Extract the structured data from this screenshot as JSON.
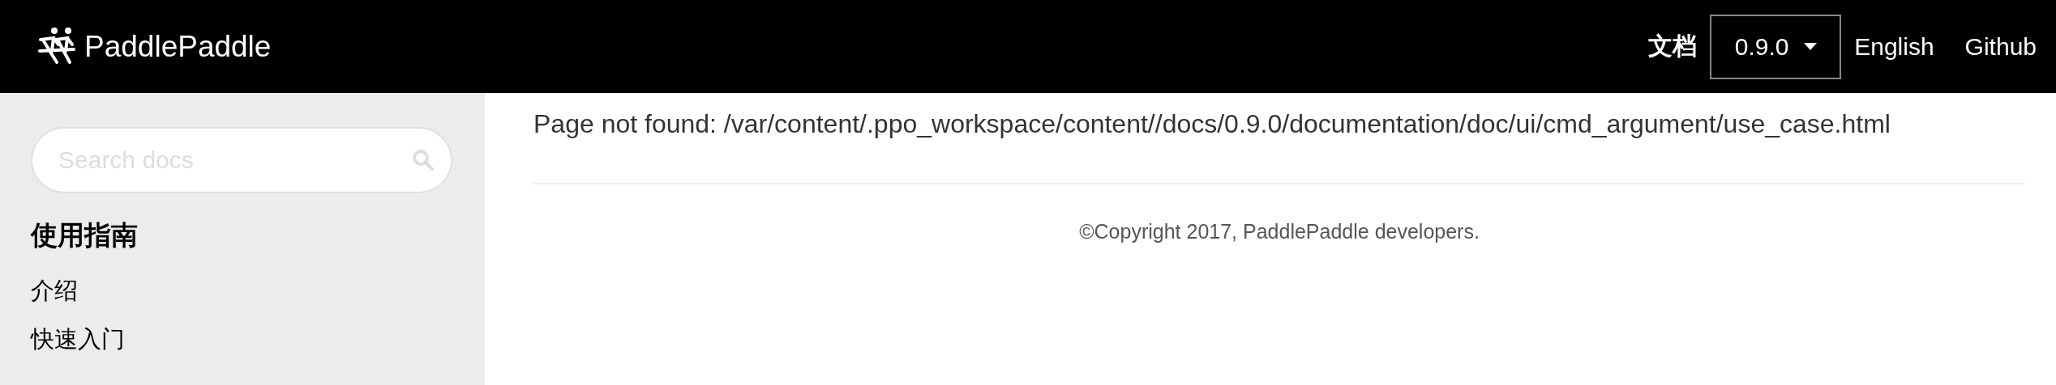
{
  "header": {
    "logo_text": "PaddlePaddle",
    "nav": [
      {
        "kind": "label",
        "text": "文档"
      },
      {
        "kind": "dropdown",
        "text": "0.9.0"
      },
      {
        "kind": "link",
        "text": "English"
      },
      {
        "kind": "link",
        "text": "Github"
      }
    ]
  },
  "sidebar": {
    "search": {
      "placeholder": "Search docs"
    },
    "heading": "使用指南",
    "items": [
      "介绍",
      "快速入门"
    ]
  },
  "content": {
    "message": "Page not found: /var/content/.ppo_workspace/content//docs/0.9.0/documentation/doc/ui/cmd_argument/use_case.html",
    "footer": "©Copyright 2017, PaddlePaddle developers."
  }
}
